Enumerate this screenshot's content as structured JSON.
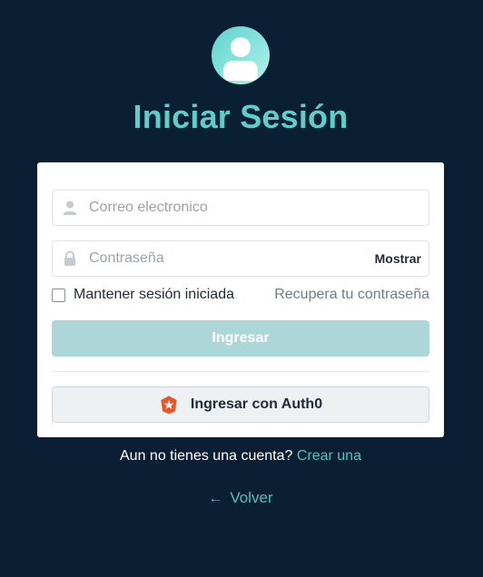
{
  "header": {
    "title": "Iniciar Sesión",
    "avatar_icon": "user-icon"
  },
  "form": {
    "email": {
      "placeholder": "Correo electronico",
      "value": "",
      "icon": "user-icon"
    },
    "password": {
      "placeholder": "Contraseña",
      "value": "",
      "icon": "lock-icon",
      "show_label": "Mostrar"
    },
    "remember_label": "Mantener sesión iniciada",
    "remember_checked": false,
    "recover_label": "Recupera tu contraseña",
    "submit_label": "Ingresar",
    "auth0_label": "Ingresar con Auth0",
    "auth0_icon": "auth0-icon"
  },
  "footer": {
    "signup_text": "Aun no tienes una cuenta?",
    "signup_link": "Crear una",
    "back_label": "Volver",
    "back_icon": "arrow-left-icon"
  },
  "colors": {
    "background": "#0a1f33",
    "accent": "#5ecfc8",
    "submit_disabled": "#acd6d7",
    "auth0_brand": "#eb5424"
  }
}
